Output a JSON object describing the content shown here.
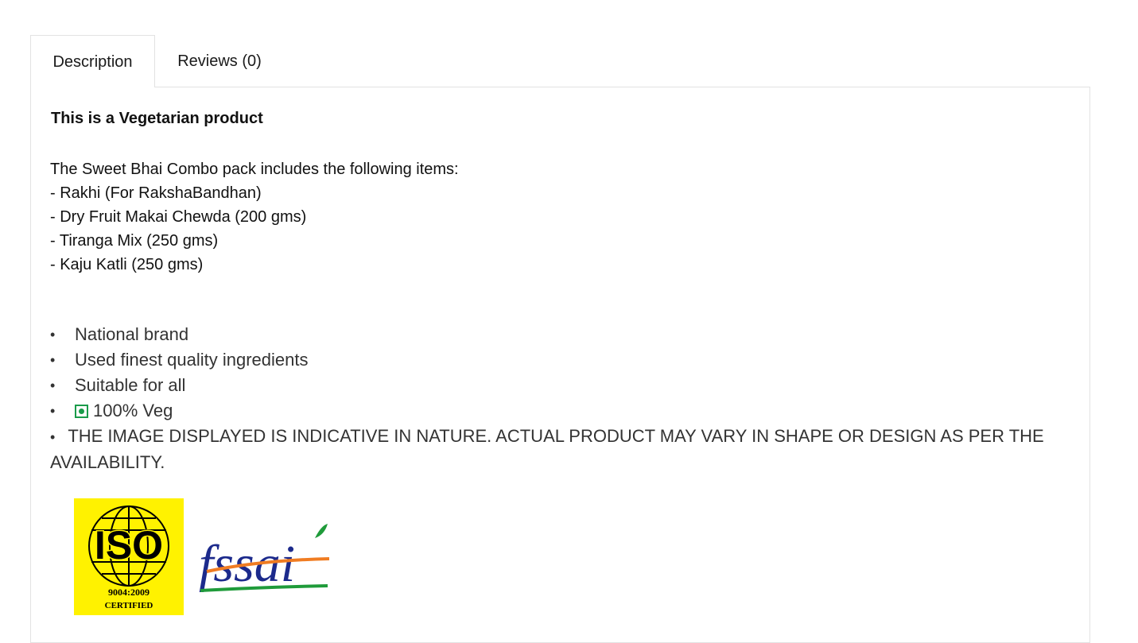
{
  "tabs": [
    {
      "label": "Description",
      "active": true
    },
    {
      "label": "Reviews (0)",
      "active": false
    }
  ],
  "description": {
    "veg_note": "This is a Vegetarian product",
    "intro_lines": [
      "The Sweet Bhai Combo pack includes the following items:",
      "- Rakhi (For RakshaBandhan)",
      "- Dry Fruit Makai Chewda (200 gms)",
      "- Tiranga Mix (250 gms)",
      "- Kaju Katli (250 gms)"
    ],
    "bullet_char": "•",
    "features": [
      "National brand",
      "Used finest quality ingredients",
      "Suitable for all",
      "100% Veg",
      "THE IMAGE DISPLAYED IS INDICATIVE IN NATURE. ACTUAL PRODUCT MAY VARY IN SHAPE OR DESIGN AS PER THE AVAILABILITY."
    ]
  },
  "logos": {
    "iso": {
      "text": "ISO",
      "line1": "9004:2009",
      "line2": "CERTIFIED",
      "bg_color": "#fff200"
    },
    "fssai": {
      "text": "fssai",
      "text_color": "#1c2a8c",
      "orange": "#f07c22",
      "green": "#1f9b3a"
    }
  },
  "colors": {
    "veg_green": "#1a9b4a",
    "border": "#e2e2e2"
  }
}
